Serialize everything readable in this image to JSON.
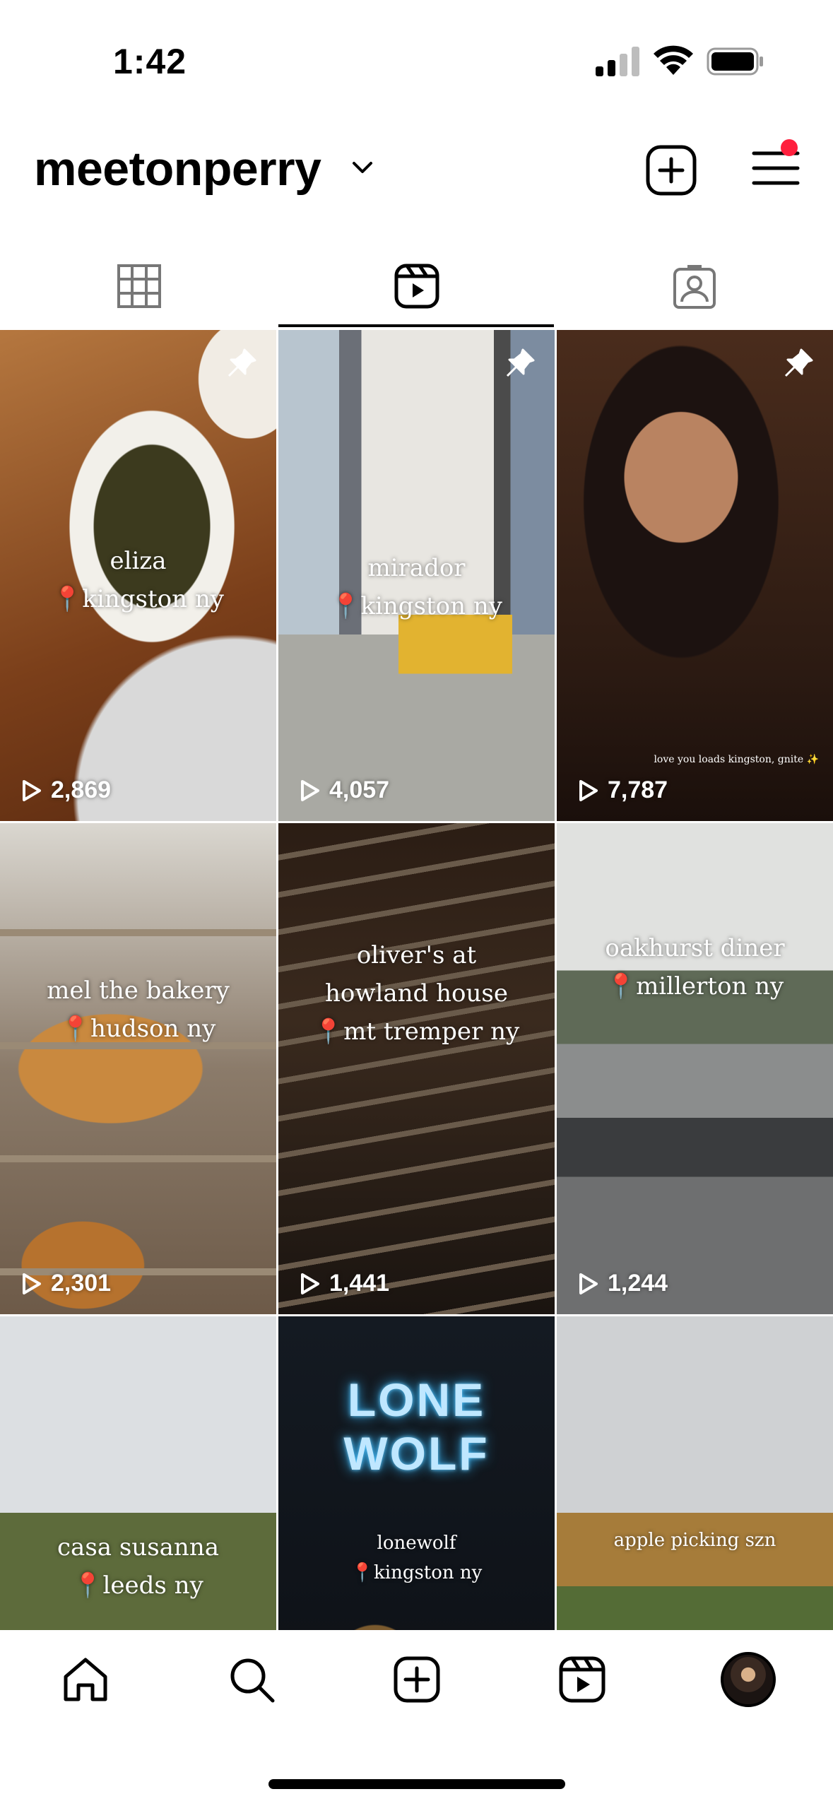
{
  "status_bar": {
    "time": "1:42"
  },
  "header": {
    "username": "meetonperry"
  },
  "tabs": [
    {
      "name": "grid",
      "icon": "grid-icon"
    },
    {
      "name": "reels",
      "icon": "reels-icon",
      "active": true
    },
    {
      "name": "tagged",
      "icon": "tagged-icon"
    }
  ],
  "reels": [
    {
      "line1": "eliza",
      "line2": "📍kingston ny",
      "line3": "",
      "views": "2,869",
      "pinned": true
    },
    {
      "line1": "mirador",
      "line2": "📍kingston ny",
      "line3": "",
      "views": "4,057",
      "pinned": true
    },
    {
      "line1": "",
      "line2": "",
      "line3": "",
      "caption_small": "love you loads kingston, gnite ✨",
      "views": "7,787",
      "pinned": true
    },
    {
      "line1": "mel the bakery",
      "line2": "📍hudson ny",
      "line3": "",
      "views": "2,301",
      "pinned": false
    },
    {
      "line1": "oliver's at",
      "line2": "howland house",
      "line3": "📍mt tremper ny",
      "views": "1,441",
      "pinned": false
    },
    {
      "line1": "oakhurst diner",
      "line2": "📍millerton ny",
      "line3": "",
      "views": "1,244",
      "pinned": false
    },
    {
      "line1": "casa susanna",
      "line2": "📍leeds ny",
      "line3": "",
      "views": "",
      "pinned": false
    },
    {
      "line1": "lonewolf",
      "line2": "📍kingston ny",
      "line3": "",
      "sign_text": "LONE WOLF",
      "views": "",
      "pinned": false
    },
    {
      "line1": "apple picking szn",
      "line2": "",
      "line3": "",
      "views": "",
      "pinned": false
    }
  ],
  "bottom_nav": [
    {
      "name": "home",
      "icon": "home-icon"
    },
    {
      "name": "search",
      "icon": "search-icon"
    },
    {
      "name": "create",
      "icon": "create-icon"
    },
    {
      "name": "reels",
      "icon": "reels-icon"
    },
    {
      "name": "profile",
      "icon": "profile-avatar"
    }
  ],
  "colors": {
    "notification_dot": "#ff1f3d",
    "text": "#000000",
    "background": "#ffffff"
  }
}
